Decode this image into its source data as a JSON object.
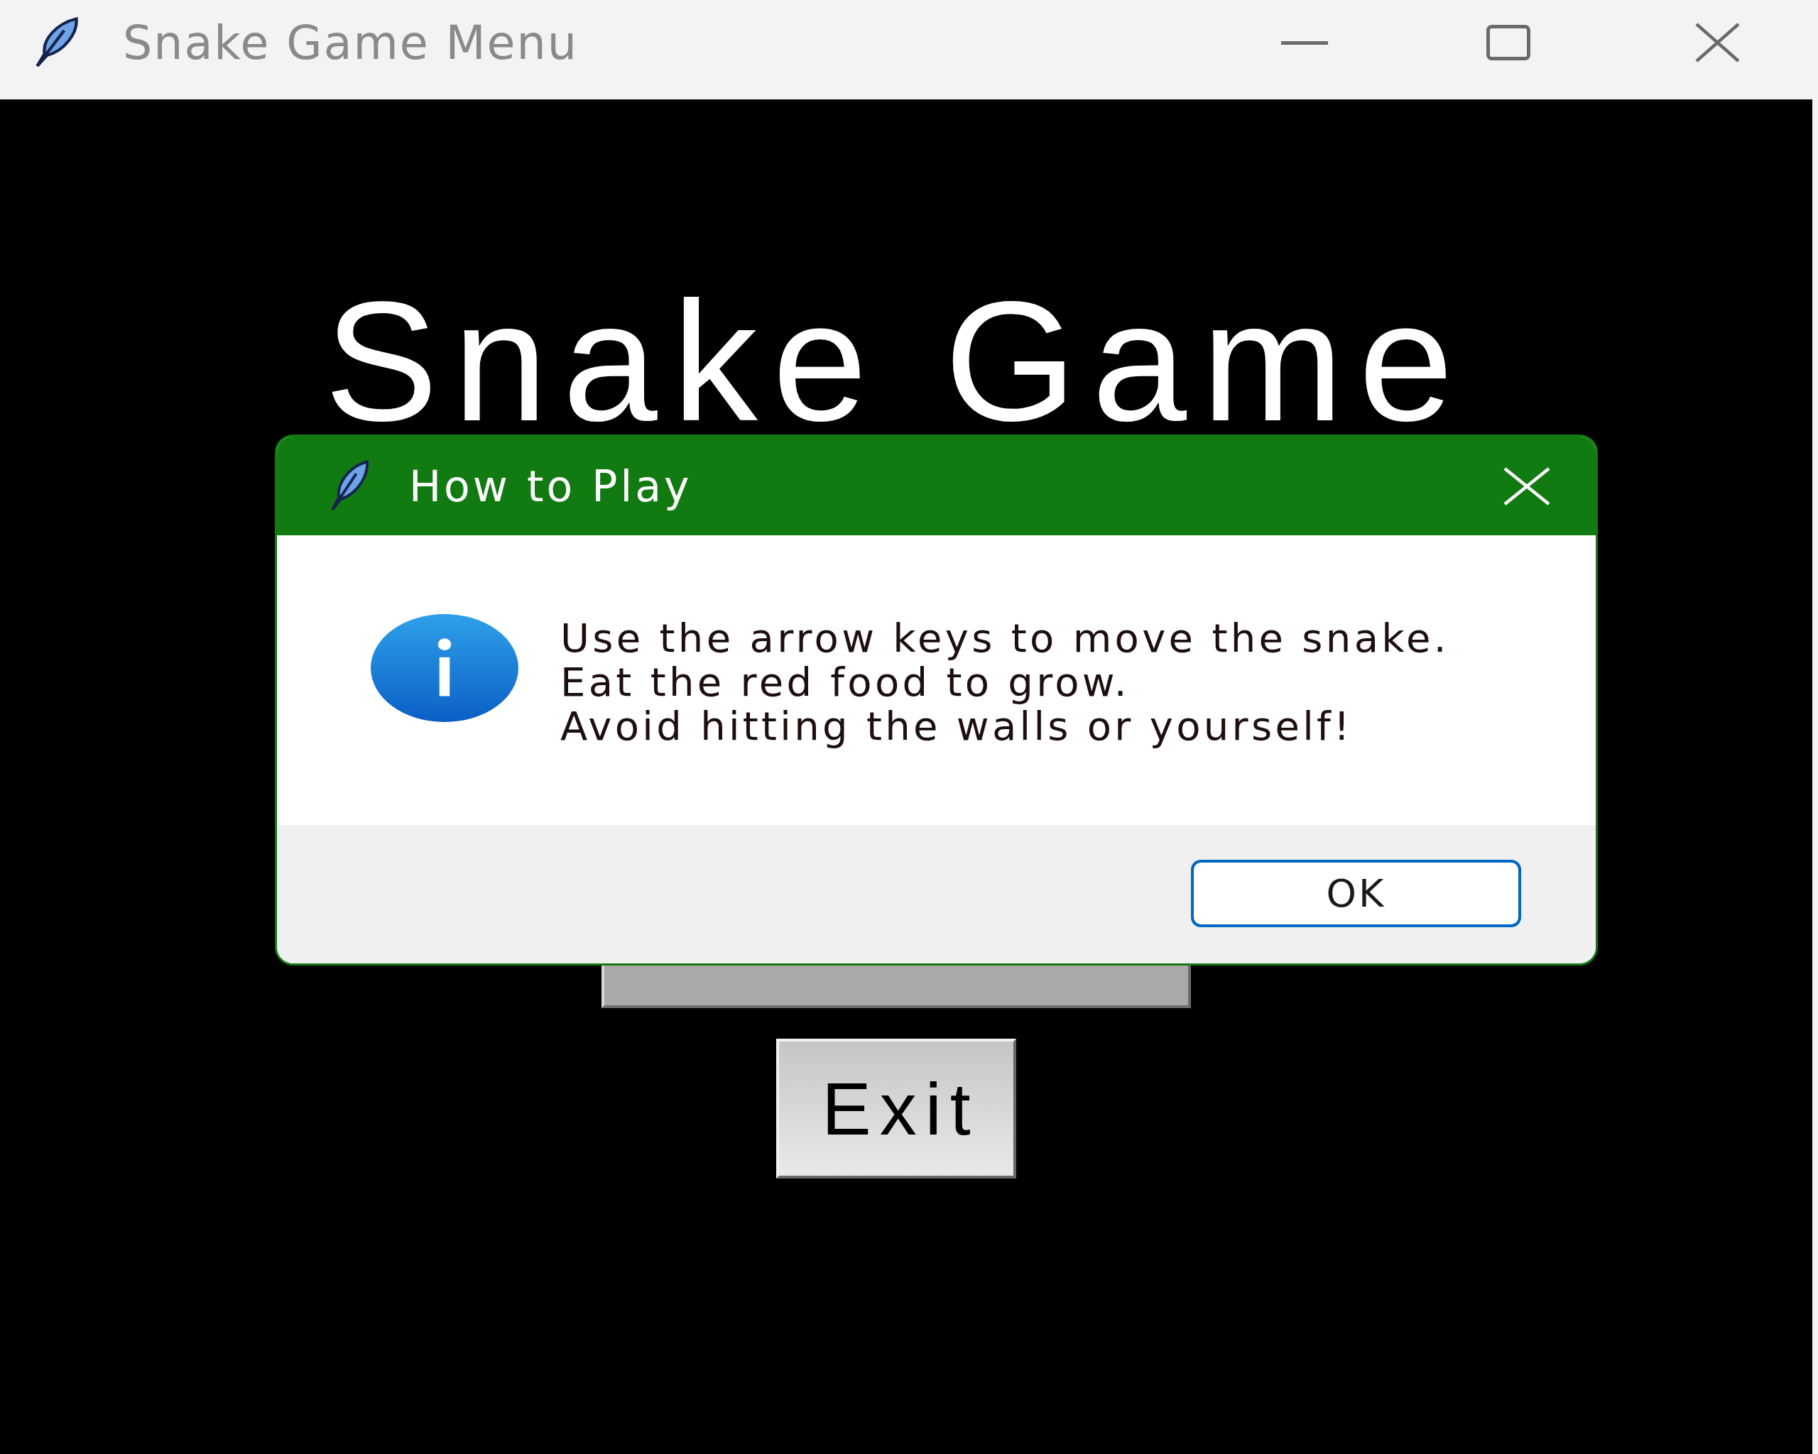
{
  "window": {
    "title": "Snake Game Menu",
    "active": false
  },
  "menu": {
    "heading": "Snake Game",
    "exit_button": "Exit"
  },
  "dialog": {
    "title": "How to Play",
    "message": [
      "Use the arrow keys to move the snake.",
      "Eat the red food to grow.",
      "Avoid hitting the walls or yourself!"
    ],
    "buttons": [
      {
        "label": "OK",
        "focused": true
      }
    ]
  }
}
